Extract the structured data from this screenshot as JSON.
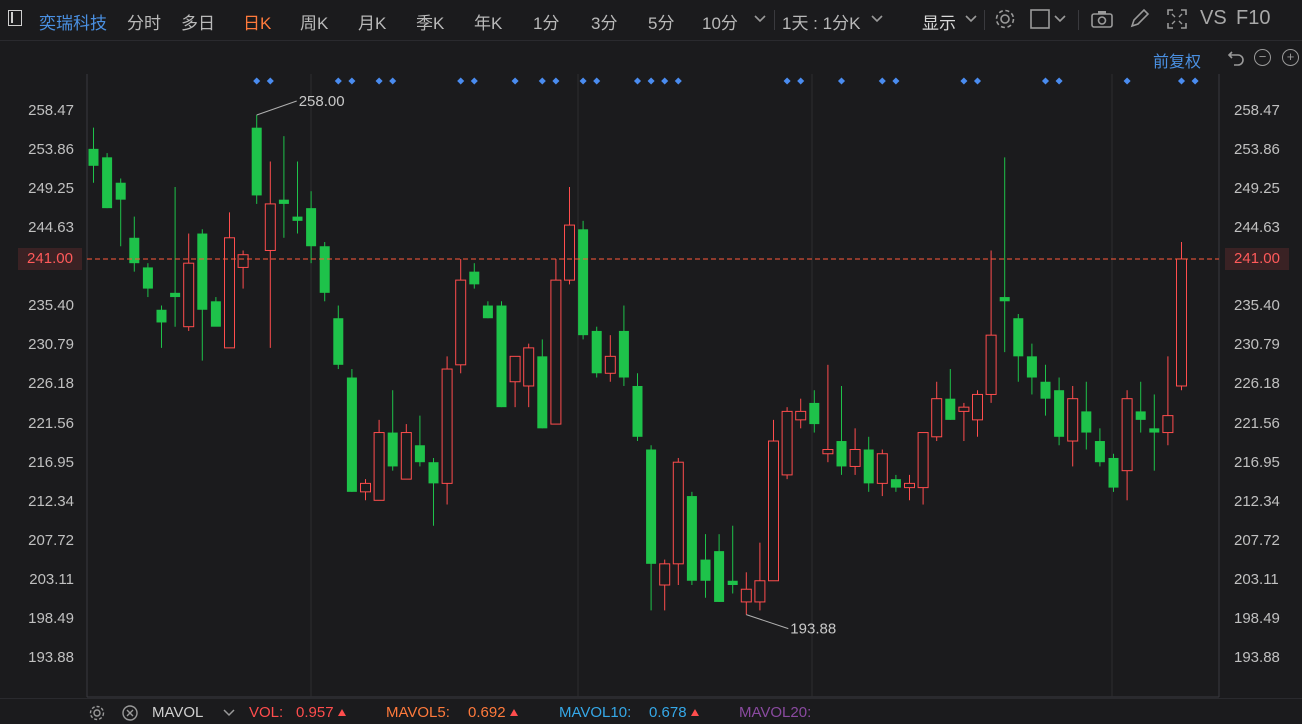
{
  "toolbar": {
    "stock_name": "奕瑞科技",
    "periods": [
      "分时",
      "多日",
      "日K",
      "周K",
      "月K",
      "季K",
      "年K",
      "1分",
      "3分",
      "5分",
      "10分"
    ],
    "active_period": "日K",
    "period_selector": "1天 : 1分K",
    "display_label": "显示",
    "vs_label": "VS",
    "f10_label": "F10",
    "adjust_label": "前复权"
  },
  "footer": {
    "indicator": "MAVOL",
    "vol_label": "VOL:",
    "vol_value": "0.957",
    "mavol5_label": "MAVOL5:",
    "mavol5_value": "0.692",
    "mavol10_label": "MAVOL10:",
    "mavol10_value": "0.678",
    "mavol20_label": "MAVOL20:"
  },
  "colors": {
    "up": "#ff4d4d",
    "down": "#1ec24a",
    "accent_orange": "#ff7a3c",
    "blue": "#4a90e2",
    "dots": "#4a8cf0",
    "mavol20": "#8a4aa0"
  },
  "chart_data": {
    "type": "candlestick",
    "y_ticks": [
      "258.47",
      "253.86",
      "249.25",
      "244.63",
      "241.00",
      "235.40",
      "230.79",
      "226.18",
      "221.56",
      "216.95",
      "212.34",
      "207.72",
      "203.11",
      "198.49",
      "193.88"
    ],
    "ylim": [
      193.88,
      258.47
    ],
    "current_price": "241.00",
    "max_label": "258.00",
    "min_label": "193.88",
    "candles": [
      {
        "o": 254.0,
        "h": 256.5,
        "l": 250.0,
        "c": 252.0
      },
      {
        "o": 253.0,
        "h": 253.5,
        "l": 247.0,
        "c": 247.0
      },
      {
        "o": 250.0,
        "h": 250.5,
        "l": 242.5,
        "c": 248.0
      },
      {
        "o": 243.5,
        "h": 246.0,
        "l": 239.5,
        "c": 240.5
      },
      {
        "o": 240.0,
        "h": 240.5,
        "l": 236.5,
        "c": 237.5
      },
      {
        "o": 235.0,
        "h": 235.5,
        "l": 230.5,
        "c": 233.5
      },
      {
        "o": 237.0,
        "h": 249.5,
        "l": 233.0,
        "c": 236.5
      },
      {
        "o": 233.0,
        "h": 244.0,
        "l": 232.5,
        "c": 240.5
      },
      {
        "o": 244.0,
        "h": 244.5,
        "l": 229.0,
        "c": 235.0
      },
      {
        "o": 236.0,
        "h": 236.5,
        "l": 233.5,
        "c": 233.0
      },
      {
        "o": 230.5,
        "h": 246.5,
        "l": 230.5,
        "c": 243.5
      },
      {
        "o": 240.0,
        "h": 242.0,
        "l": 237.5,
        "c": 241.5
      },
      {
        "o": 256.5,
        "h": 258.0,
        "l": 247.5,
        "c": 248.5
      },
      {
        "o": 242.0,
        "h": 252.5,
        "l": 230.5,
        "c": 247.5
      },
      {
        "o": 248.0,
        "h": 255.5,
        "l": 243.5,
        "c": 247.5
      },
      {
        "o": 246.0,
        "h": 252.5,
        "l": 244.0,
        "c": 245.5
      },
      {
        "o": 247.0,
        "h": 249.0,
        "l": 240.5,
        "c": 242.5
      },
      {
        "o": 242.5,
        "h": 243.0,
        "l": 236.0,
        "c": 237.0
      },
      {
        "o": 234.0,
        "h": 235.5,
        "l": 228.0,
        "c": 228.5
      },
      {
        "o": 227.0,
        "h": 228.0,
        "l": 213.5,
        "c": 213.5
      },
      {
        "o": 213.5,
        "h": 215.0,
        "l": 212.5,
        "c": 214.5
      },
      {
        "o": 212.5,
        "h": 222.0,
        "l": 212.5,
        "c": 220.5
      },
      {
        "o": 220.5,
        "h": 225.5,
        "l": 216.0,
        "c": 216.5
      },
      {
        "o": 215.0,
        "h": 221.5,
        "l": 215.0,
        "c": 220.5
      },
      {
        "o": 219.0,
        "h": 222.5,
        "l": 216.5,
        "c": 217.0
      },
      {
        "o": 217.0,
        "h": 217.5,
        "l": 209.5,
        "c": 214.5
      },
      {
        "o": 214.5,
        "h": 229.5,
        "l": 212.0,
        "c": 228.0
      },
      {
        "o": 228.5,
        "h": 241.0,
        "l": 227.5,
        "c": 238.5
      },
      {
        "o": 239.5,
        "h": 240.5,
        "l": 237.5,
        "c": 238.0
      },
      {
        "o": 235.5,
        "h": 236.0,
        "l": 234.0,
        "c": 234.0
      },
      {
        "o": 235.5,
        "h": 236.0,
        "l": 223.5,
        "c": 223.5
      },
      {
        "o": 226.5,
        "h": 229.5,
        "l": 223.5,
        "c": 229.5
      },
      {
        "o": 226.0,
        "h": 231.0,
        "l": 223.5,
        "c": 230.5
      },
      {
        "o": 229.5,
        "h": 231.5,
        "l": 221.0,
        "c": 221.0
      },
      {
        "o": 221.5,
        "h": 241.0,
        "l": 221.5,
        "c": 238.5
      },
      {
        "o": 238.5,
        "h": 249.5,
        "l": 238.0,
        "c": 245.0
      },
      {
        "o": 244.5,
        "h": 245.5,
        "l": 231.5,
        "c": 232.0
      },
      {
        "o": 232.5,
        "h": 233.0,
        "l": 227.0,
        "c": 227.5
      },
      {
        "o": 227.5,
        "h": 232.0,
        "l": 226.5,
        "c": 229.5
      },
      {
        "o": 232.5,
        "h": 235.5,
        "l": 226.0,
        "c": 227.0
      },
      {
        "o": 226.0,
        "h": 227.5,
        "l": 219.5,
        "c": 220.0
      },
      {
        "o": 218.5,
        "h": 219.0,
        "l": 199.5,
        "c": 205.0
      },
      {
        "o": 202.5,
        "h": 205.5,
        "l": 199.5,
        "c": 205.0
      },
      {
        "o": 205.0,
        "h": 217.5,
        "l": 202.5,
        "c": 217.0
      },
      {
        "o": 213.0,
        "h": 213.5,
        "l": 202.5,
        "c": 203.0
      },
      {
        "o": 205.5,
        "h": 208.5,
        "l": 201.0,
        "c": 203.0
      },
      {
        "o": 206.5,
        "h": 208.5,
        "l": 200.5,
        "c": 200.5
      },
      {
        "o": 203.0,
        "h": 209.5,
        "l": 201.5,
        "c": 202.5
      },
      {
        "o": 200.5,
        "h": 204.0,
        "l": 199.0,
        "c": 202.0
      },
      {
        "o": 200.5,
        "h": 207.5,
        "l": 199.5,
        "c": 203.0
      },
      {
        "o": 203.0,
        "h": 222.0,
        "l": 203.0,
        "c": 219.5
      },
      {
        "o": 215.5,
        "h": 223.5,
        "l": 215.0,
        "c": 223.0
      },
      {
        "o": 222.0,
        "h": 224.5,
        "l": 221.0,
        "c": 223.0
      },
      {
        "o": 224.0,
        "h": 225.5,
        "l": 220.5,
        "c": 221.5
      },
      {
        "o": 218.0,
        "h": 228.5,
        "l": 217.0,
        "c": 218.5
      },
      {
        "o": 219.5,
        "h": 226.0,
        "l": 215.5,
        "c": 216.5
      },
      {
        "o": 216.5,
        "h": 221.0,
        "l": 215.5,
        "c": 218.5
      },
      {
        "o": 218.5,
        "h": 220.0,
        "l": 213.5,
        "c": 214.5
      },
      {
        "o": 214.5,
        "h": 218.5,
        "l": 213.0,
        "c": 218.0
      },
      {
        "o": 215.0,
        "h": 215.5,
        "l": 213.5,
        "c": 214.0
      },
      {
        "o": 214.0,
        "h": 215.5,
        "l": 212.5,
        "c": 214.5
      },
      {
        "o": 214.0,
        "h": 220.5,
        "l": 212.0,
        "c": 220.5
      },
      {
        "o": 220.0,
        "h": 226.5,
        "l": 219.5,
        "c": 224.5
      },
      {
        "o": 224.5,
        "h": 228.0,
        "l": 222.0,
        "c": 222.0
      },
      {
        "o": 223.0,
        "h": 224.0,
        "l": 219.5,
        "c": 223.5
      },
      {
        "o": 222.0,
        "h": 225.5,
        "l": 220.0,
        "c": 225.0
      },
      {
        "o": 225.0,
        "h": 242.0,
        "l": 224.0,
        "c": 232.0
      },
      {
        "o": 236.5,
        "h": 253.0,
        "l": 230.0,
        "c": 236.0
      },
      {
        "o": 234.0,
        "h": 234.5,
        "l": 226.5,
        "c": 229.5
      },
      {
        "o": 229.5,
        "h": 231.0,
        "l": 225.0,
        "c": 227.0
      },
      {
        "o": 226.5,
        "h": 228.5,
        "l": 222.5,
        "c": 224.5
      },
      {
        "o": 225.5,
        "h": 227.0,
        "l": 219.0,
        "c": 220.0
      },
      {
        "o": 219.5,
        "h": 226.0,
        "l": 216.5,
        "c": 224.5
      },
      {
        "o": 223.0,
        "h": 226.5,
        "l": 218.5,
        "c": 220.5
      },
      {
        "o": 219.5,
        "h": 221.0,
        "l": 216.5,
        "c": 217.0
      },
      {
        "o": 217.5,
        "h": 218.0,
        "l": 213.5,
        "c": 214.0
      },
      {
        "o": 216.0,
        "h": 225.5,
        "l": 212.5,
        "c": 224.5
      },
      {
        "o": 223.0,
        "h": 226.5,
        "l": 220.5,
        "c": 222.0
      },
      {
        "o": 221.0,
        "h": 225.0,
        "l": 216.0,
        "c": 220.5
      },
      {
        "o": 220.5,
        "h": 229.5,
        "l": 219.0,
        "c": 222.5
      },
      {
        "o": 226.0,
        "h": 243.0,
        "l": 225.5,
        "c": 241.0
      }
    ],
    "marker_indices": [
      12,
      13,
      18,
      19,
      21,
      22,
      27,
      28,
      31,
      33,
      34,
      36,
      37,
      40,
      41,
      42,
      43,
      51,
      52,
      55,
      58,
      59,
      64,
      65,
      70,
      71,
      76,
      80,
      81
    ]
  }
}
